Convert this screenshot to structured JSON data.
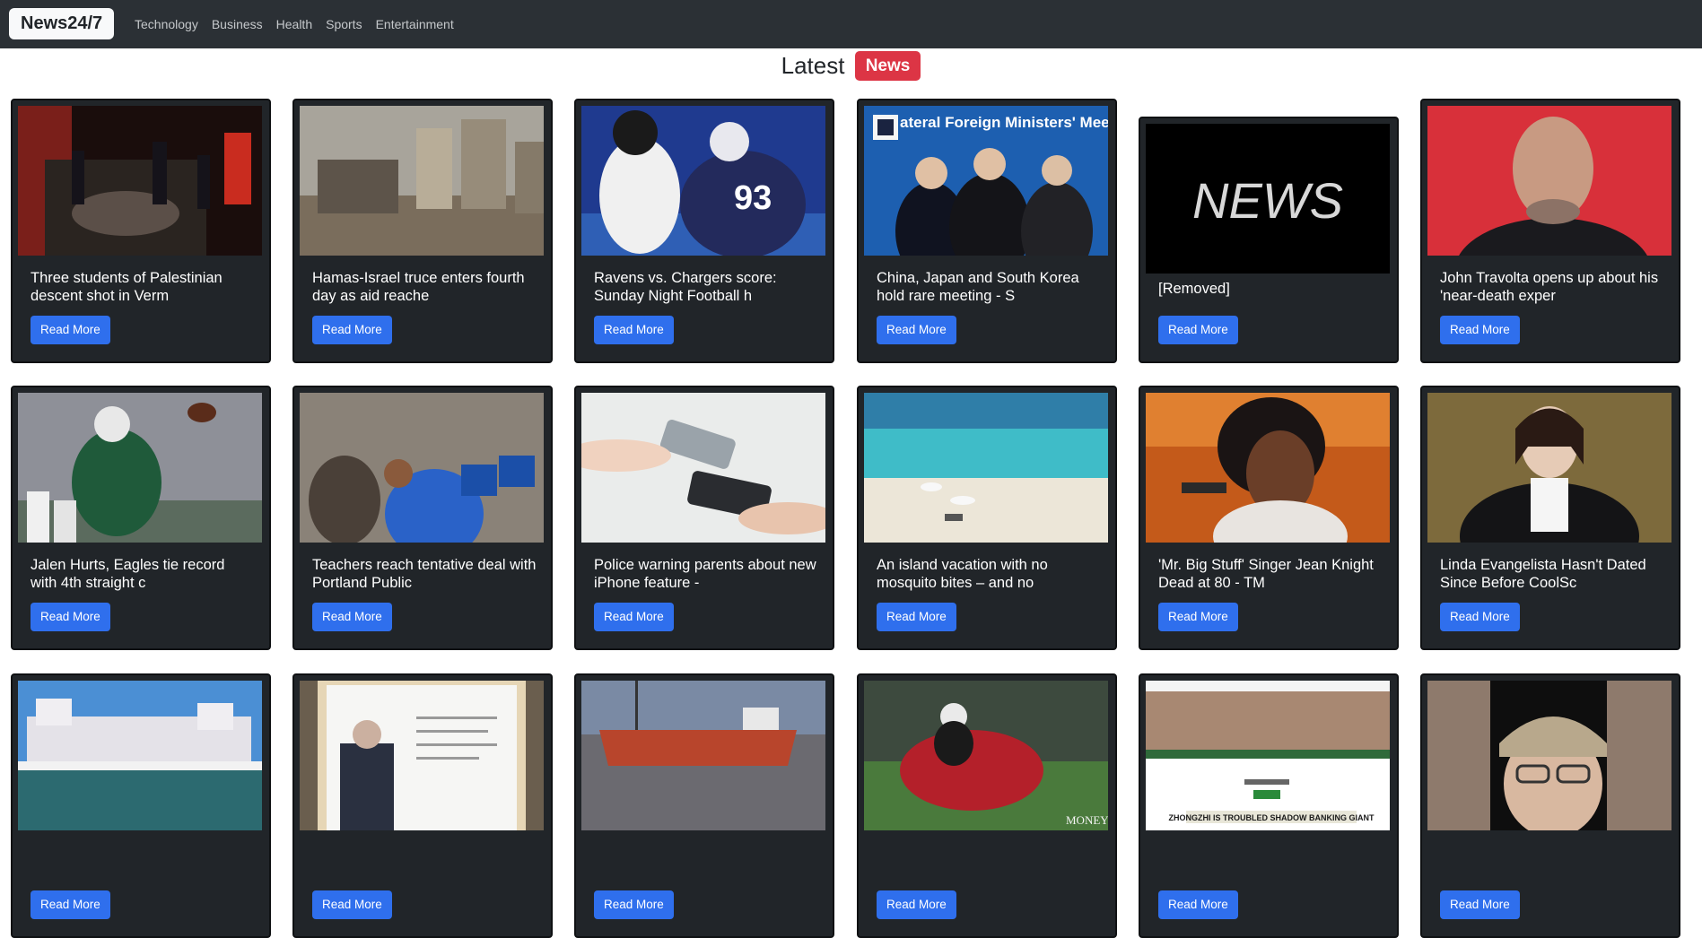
{
  "navbar": {
    "brand": "News24/7",
    "links": [
      "Technology",
      "Business",
      "Health",
      "Sports",
      "Entertainment"
    ]
  },
  "heading": {
    "text": "Latest",
    "badge": "News"
  },
  "read_more_label": "Read More",
  "colors": {
    "navbar": "#2b3035",
    "card": "#212529",
    "button": "#2f6fed",
    "badge": "#dc3545"
  },
  "articles": [
    {
      "title": "Three students of Palestinian descent shot in Verm",
      "image": "night-emergency-scene"
    },
    {
      "title": "Hamas-Israel truce enters fourth day as aid reache",
      "image": "destroyed-buildings"
    },
    {
      "title": "Ravens vs. Chargers score: Sunday Night Football h",
      "image": "football-players"
    },
    {
      "title": "China, Japan and South Korea hold rare meeting - S",
      "image": "foreign-ministers-meeting",
      "image_text": "ateral Foreign Ministers' Mee"
    },
    {
      "title": "[Removed]",
      "image": "news-logo",
      "image_text": "NEWS"
    },
    {
      "title": "John Travolta opens up about his 'near-death exper",
      "image": "portrait-man"
    },
    {
      "title": "Jalen Hurts, Eagles tie record with 4th straight c",
      "image": "football-player-throwing"
    },
    {
      "title": "Teachers reach tentative deal with Portland Public",
      "image": "meeting-crowd"
    },
    {
      "title": "Police warning parents about new iPhone feature -",
      "image": "phones-handoff"
    },
    {
      "title": "An island vacation with no mosquito bites – and no",
      "image": "beach"
    },
    {
      "title": "'Mr. Big Stuff' Singer Jean Knight Dead at 80 - TM",
      "image": "singer-portrait"
    },
    {
      "title": "Linda Evangelista Hasn't Dated Since Before CoolSc",
      "image": "portrait-woman"
    },
    {
      "title": "",
      "image": "theme-park"
    },
    {
      "title": "",
      "image": "memorial-plaque"
    },
    {
      "title": "",
      "image": "tanker-ship"
    },
    {
      "title": "",
      "image": "football-scrum",
      "image_text": "MONEY"
    },
    {
      "title": "",
      "image": "website-screenshot",
      "image_text": "ZHONGZHI IS TROUBLED SHADOW BANKING GIANT"
    },
    {
      "title": "",
      "image": "man-in-cap"
    }
  ]
}
